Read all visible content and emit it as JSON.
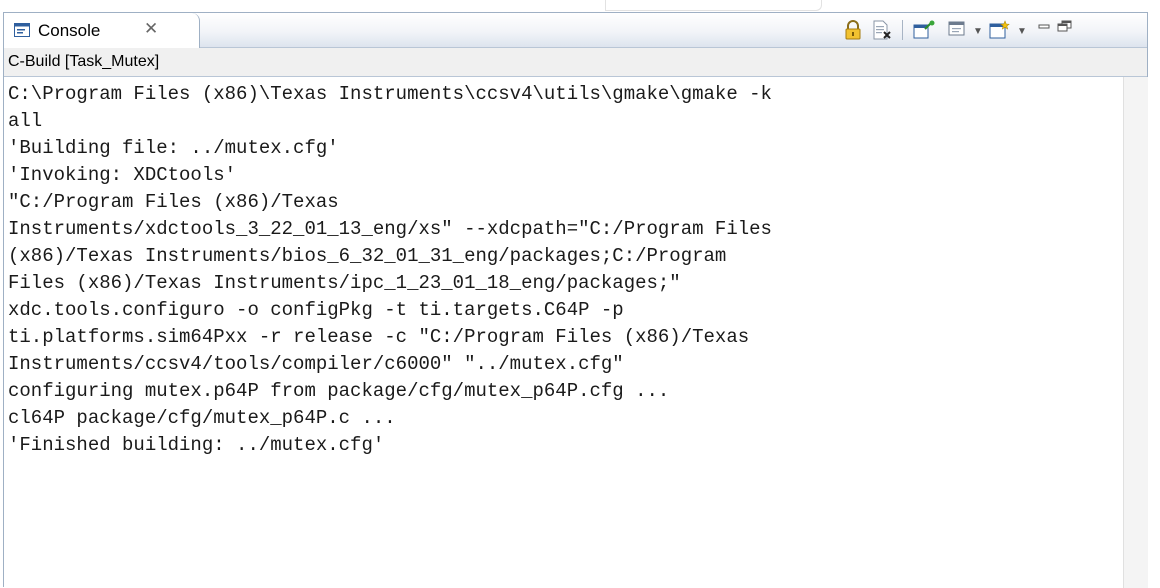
{
  "tab": {
    "label": "Console",
    "close_glyph": "✕",
    "icon": "console-icon"
  },
  "toolbar": {
    "items": [
      "scroll-lock-icon",
      "clear-console-icon",
      "pin-console-icon",
      "display-console-icon",
      "open-console-icon",
      "minimize-icon",
      "maximize-icon"
    ]
  },
  "subheader": {
    "title": "C-Build [Task_Mutex]"
  },
  "console": {
    "lines": [
      "C:\\Program Files (x86)\\Texas Instruments\\ccsv4\\utils\\gmake\\gmake -k",
      "all",
      "'Building file: ../mutex.cfg'",
      "'Invoking: XDCtools'",
      "\"C:/Program Files (x86)/Texas",
      "Instruments/xdctools_3_22_01_13_eng/xs\" --xdcpath=\"C:/Program Files",
      "(x86)/Texas Instruments/bios_6_32_01_31_eng/packages;C:/Program",
      "Files (x86)/Texas Instruments/ipc_1_23_01_18_eng/packages;\"",
      "xdc.tools.configuro -o configPkg -t ti.targets.C64P -p",
      "ti.platforms.sim64Pxx -r release -c \"C:/Program Files (x86)/Texas",
      "Instruments/ccsv4/tools/compiler/c6000\" \"../mutex.cfg\"",
      "configuring mutex.p64P from package/cfg/mutex_p64P.cfg ...",
      "cl64P package/cfg/mutex_p64P.c ...",
      "'Finished building: ../mutex.cfg'"
    ]
  }
}
